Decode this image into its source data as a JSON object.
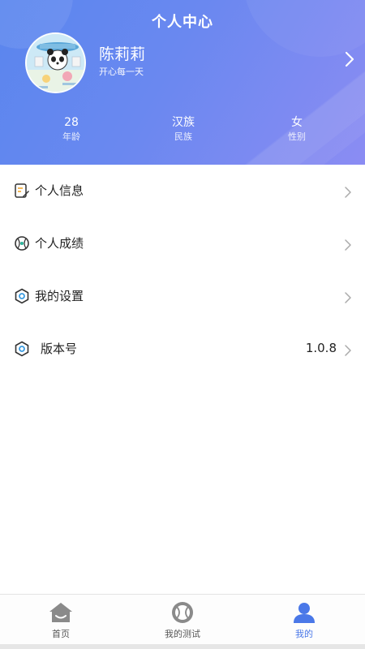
{
  "header": {
    "title": "个人中心",
    "gradient_start": "#5a86ee",
    "gradient_end": "#8b8cf3"
  },
  "profile": {
    "name": "陈莉莉",
    "motto": "开心每一天",
    "avatar_icon": "panda-avatar-icon"
  },
  "stats": [
    {
      "value": "28",
      "label": "年龄"
    },
    {
      "value": "汉族",
      "label": "民族"
    },
    {
      "value": "女",
      "label": "性别"
    }
  ],
  "menu": [
    {
      "label": "个人信息",
      "icon": "edit-document-icon",
      "value": ""
    },
    {
      "label": "个人成绩",
      "icon": "baseball-icon",
      "value": ""
    },
    {
      "label": "我的设置",
      "icon": "hexagon-settings-icon",
      "value": ""
    },
    {
      "label": "版本号",
      "icon": "hexagon-settings-icon",
      "value": "1.0.8"
    }
  ],
  "tabbar": {
    "active_color": "#4a78e8",
    "tabs": [
      {
        "label": "首页",
        "icon": "home-icon",
        "active": false
      },
      {
        "label": "我的测试",
        "icon": "baseball-icon",
        "active": false
      },
      {
        "label": "我的",
        "icon": "user-icon",
        "active": true
      }
    ]
  }
}
